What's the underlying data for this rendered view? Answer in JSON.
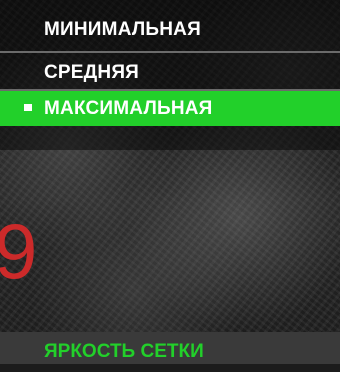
{
  "menu": {
    "items": [
      {
        "label": "МИНИМАЛЬНАЯ",
        "selected": false
      },
      {
        "label": "СРЕДНЯЯ",
        "selected": false
      },
      {
        "label": "МАКСИМАЛЬНАЯ",
        "selected": true
      }
    ]
  },
  "overlay": {
    "number": "9"
  },
  "footer": {
    "title": "ЯРКОСТЬ СЕТКИ"
  },
  "colors": {
    "accent": "#22d02a",
    "number": "#cc2a2a",
    "text": "#ffffff"
  }
}
